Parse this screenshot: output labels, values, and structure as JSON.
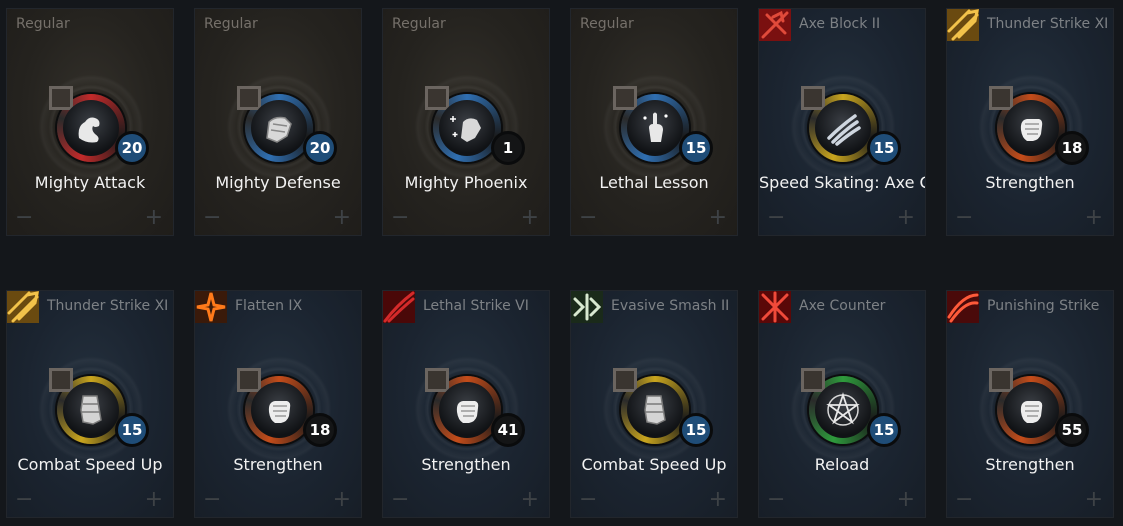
{
  "cards": [
    {
      "type": "Regular",
      "source_icon": "none",
      "ring": "#c22a2a",
      "skill_icon": "flexed-arm-icon",
      "name": "Mighty Attack",
      "level": "20",
      "badge": "blue"
    },
    {
      "type": "Regular",
      "source_icon": "none",
      "ring": "#2f6fb2",
      "skill_icon": "armored-arm-icon",
      "name": "Mighty Defense",
      "level": "20",
      "badge": "blue"
    },
    {
      "type": "Regular",
      "source_icon": "none",
      "ring": "#2f6fb2",
      "skill_icon": "sparkle-arm-icon",
      "name": "Mighty Phoenix",
      "level": "1",
      "badge": "dark"
    },
    {
      "type": "Regular",
      "source_icon": "none",
      "ring": "#2f6fb2",
      "skill_icon": "raised-finger-icon",
      "name": "Lethal Lesson",
      "level": "15",
      "badge": "blue"
    },
    {
      "type": "Axe Block II",
      "source_icon": "axe-block-icon",
      "ring": "#c9a51e",
      "skill_icon": "claw-slash-icon",
      "name": "Speed Skating: Axe Co",
      "level": "15",
      "badge": "blue"
    },
    {
      "type": "Thunder Strike XI",
      "source_icon": "thunder-strike-icon",
      "ring": "#c44c1a",
      "skill_icon": "fist-icon",
      "name": "Strengthen",
      "level": "18",
      "badge": "dark"
    },
    {
      "type": "Thunder Strike XI",
      "source_icon": "thunder-strike-icon",
      "ring": "#c9a51e",
      "skill_icon": "gauntlet-icon",
      "name": "Combat Speed Up",
      "level": "15",
      "badge": "blue"
    },
    {
      "type": "Flatten IX",
      "source_icon": "flatten-icon",
      "ring": "#c44c1a",
      "skill_icon": "fist-icon",
      "name": "Strengthen",
      "level": "18",
      "badge": "dark"
    },
    {
      "type": "Lethal Strike VI",
      "source_icon": "lethal-strike-icon",
      "ring": "#c44c1a",
      "skill_icon": "fist-icon",
      "name": "Strengthen",
      "level": "41",
      "badge": "dark"
    },
    {
      "type": "Evasive Smash II",
      "source_icon": "evasive-smash-icon",
      "ring": "#c9a51e",
      "skill_icon": "gauntlet-icon",
      "name": "Combat Speed Up",
      "level": "15",
      "badge": "blue"
    },
    {
      "type": "Axe Counter",
      "source_icon": "axe-counter-icon",
      "ring": "#2e9b3c",
      "skill_icon": "pentagram-icon",
      "name": "Reload",
      "level": "15",
      "badge": "blue"
    },
    {
      "type": "Punishing Strike",
      "source_icon": "punishing-strike-icon",
      "ring": "#c44c1a",
      "skill_icon": "fist-icon",
      "name": "Strengthen",
      "level": "55",
      "badge": "dark"
    }
  ],
  "controls": {
    "minus": "−",
    "plus": "+"
  },
  "colors": {
    "badge_blue": "#1f4d78",
    "badge_dark": "#141516",
    "background": "#14171b"
  }
}
